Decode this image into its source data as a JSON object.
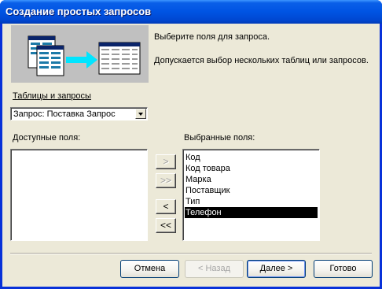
{
  "window": {
    "title": "Создание простых запросов"
  },
  "intro": {
    "line1": "Выберите поля для запроса.",
    "line2": "Допускается выбор нескольких таблиц или запросов."
  },
  "tables_label": "Таблицы и запросы",
  "tables_combo": {
    "value": "Запрос: Поставка Запрос"
  },
  "available": {
    "label": "Доступные поля:",
    "items": []
  },
  "selected": {
    "label": "Выбранные поля:",
    "items": [
      "Код",
      "Код товара",
      "Марка",
      "Поставщик",
      "Тип",
      "Телефон"
    ],
    "highlighted_index": 5
  },
  "move_buttons": {
    "add": ">",
    "add_all": ">>",
    "remove": "<",
    "remove_all": "<<"
  },
  "footer": {
    "cancel": "Отмена",
    "back": "< Назад",
    "next": "Далее >",
    "finish": "Готово"
  },
  "colors": {
    "titlebar": "#0054e3",
    "dialog_bg": "#ece9d8",
    "selection": "#000000"
  }
}
